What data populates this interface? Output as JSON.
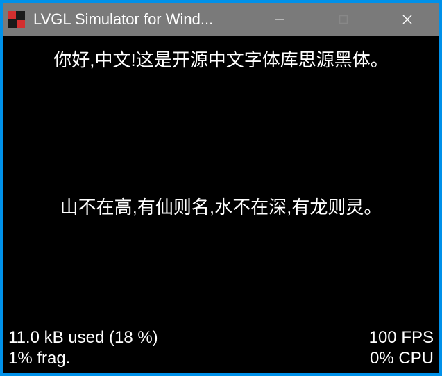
{
  "window": {
    "title": "LVGL Simulator for Wind..."
  },
  "content": {
    "line1": "你好,中文!这是开源中文字体库思源黑体。",
    "line2": "山不在高,有仙则名,水不在深,有龙则灵。"
  },
  "status": {
    "memory_used": "11.0 kB used (18 %)",
    "fragmentation": "1% frag.",
    "fps": "100 FPS",
    "cpu": "0% CPU"
  }
}
